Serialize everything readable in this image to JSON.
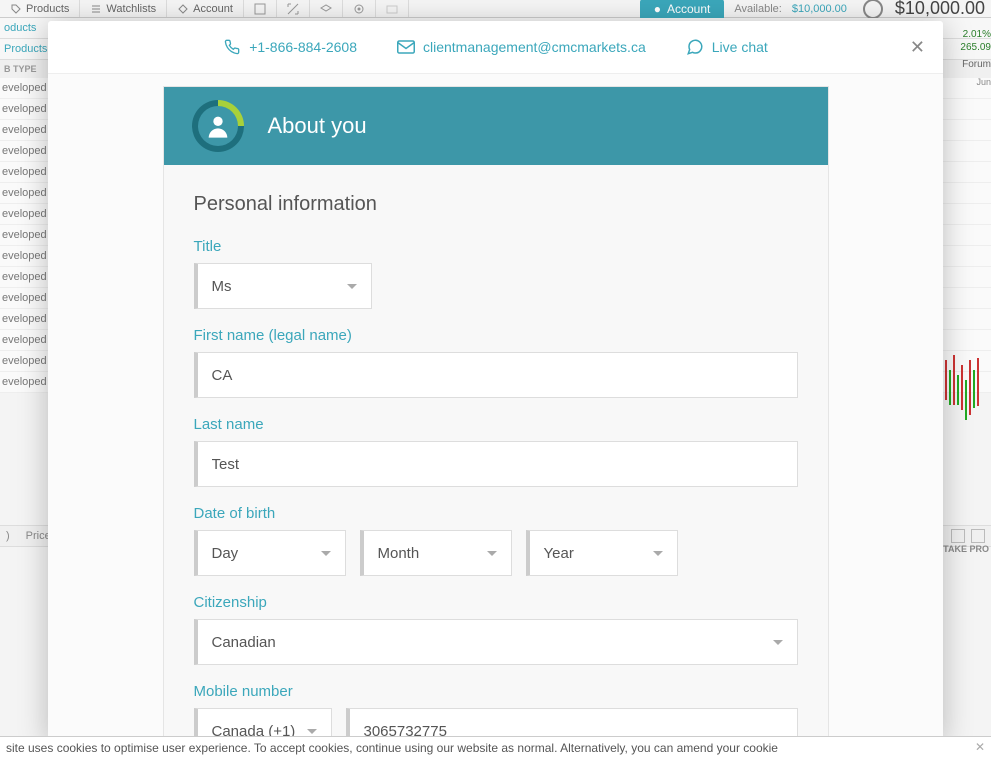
{
  "toolbar": {
    "items": [
      "Products",
      "Watchlists",
      "Account"
    ],
    "account_tab": "Account",
    "available_label": "Available:",
    "available_value": "$10,000.00",
    "balance": "$10,000.00"
  },
  "bg_left": {
    "products_tab": "oducts",
    "products_header": "Products",
    "subtype": "B TYPE",
    "row_text": "eveloped",
    "price_tab_marker": ")",
    "price_label": "Price"
  },
  "bg_right": {
    "pct": "2.01%",
    "val": "265.09",
    "forum": "Forum",
    "jun": "Jun",
    "take_pro": "TAKE PRO"
  },
  "cookie": {
    "text": "site uses cookies to optimise user experience. To accept cookies, continue using our website as normal. Alternatively, you can amend your cookie"
  },
  "modal": {
    "phone": "+1-866-884-2608",
    "email": "clientmanagement@cmcmarkets.ca",
    "chat": "Live chat"
  },
  "form": {
    "header": "About you",
    "section": "Personal information",
    "title": {
      "label": "Title",
      "value": "Ms"
    },
    "first_name": {
      "label": "First name (legal name)",
      "value": "CA"
    },
    "last_name": {
      "label": "Last name",
      "value": "Test"
    },
    "dob": {
      "label": "Date of birth",
      "day": "Day",
      "month": "Month",
      "year": "Year"
    },
    "citizenship": {
      "label": "Citizenship",
      "value": "Canadian"
    },
    "mobile": {
      "label": "Mobile number",
      "code": "Canada (+1)",
      "number": "3065732775"
    }
  }
}
